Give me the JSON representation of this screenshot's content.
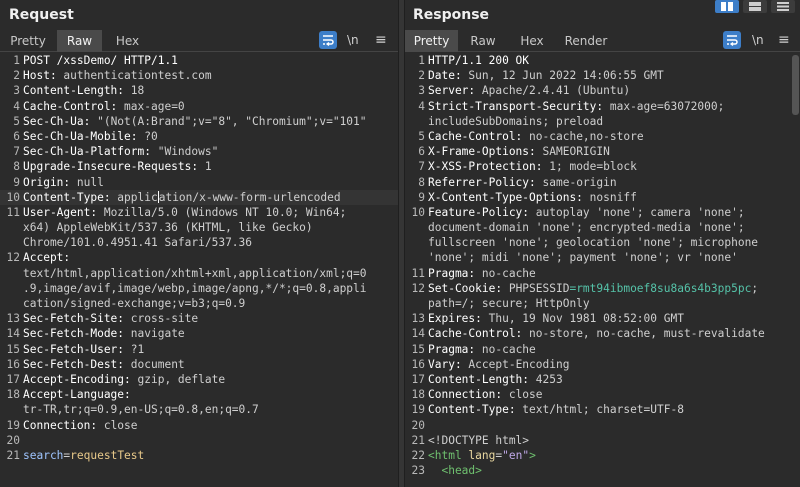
{
  "request": {
    "title": "Request",
    "tabs": [
      "Pretty",
      "Raw",
      "Hex"
    ],
    "active_tab": "Raw",
    "newline_label": "\\n",
    "lines": [
      {
        "n": "1",
        "segs": [
          {
            "t": "POST /xssDemo/ HTTP/1.1",
            "c": "hkey"
          }
        ]
      },
      {
        "n": "2",
        "segs": [
          {
            "t": "Host: ",
            "c": "hkey"
          },
          {
            "t": "authenticationtest.com",
            "c": "hval"
          }
        ]
      },
      {
        "n": "3",
        "segs": [
          {
            "t": "Content-Length: ",
            "c": "hkey"
          },
          {
            "t": "18",
            "c": "hval"
          }
        ]
      },
      {
        "n": "4",
        "segs": [
          {
            "t": "Cache-Control: ",
            "c": "hkey"
          },
          {
            "t": "max-age=0",
            "c": "hval"
          }
        ]
      },
      {
        "n": "5",
        "segs": [
          {
            "t": "Sec-Ch-Ua: ",
            "c": "hkey"
          },
          {
            "t": "\"(Not(A:Brand\";v=\"8\", \"Chromium\";v=\"101\"",
            "c": "hval"
          }
        ]
      },
      {
        "n": "6",
        "segs": [
          {
            "t": "Sec-Ch-Ua-Mobile: ",
            "c": "hkey"
          },
          {
            "t": "?0",
            "c": "hval"
          }
        ]
      },
      {
        "n": "7",
        "segs": [
          {
            "t": "Sec-Ch-Ua-Platform: ",
            "c": "hkey"
          },
          {
            "t": "\"Windows\"",
            "c": "hval"
          }
        ]
      },
      {
        "n": "8",
        "segs": [
          {
            "t": "Upgrade-Insecure-Requests: ",
            "c": "hkey"
          },
          {
            "t": "1",
            "c": "hval"
          }
        ]
      },
      {
        "n": "9",
        "segs": [
          {
            "t": "Origin: ",
            "c": "hkey"
          },
          {
            "t": "null",
            "c": "hval"
          }
        ]
      },
      {
        "n": "10",
        "hl": true,
        "segs": [
          {
            "t": "Content-Type: ",
            "c": "hkey"
          },
          {
            "t": "applic",
            "c": "hval"
          },
          {
            "caret": true
          },
          {
            "t": "ation/x-www-form-urlencoded",
            "c": "hval"
          }
        ]
      },
      {
        "n": "11",
        "segs": [
          {
            "t": "User-Agent: ",
            "c": "hkey"
          },
          {
            "t": "Mozilla/5.0 (Windows NT 10.0; Win64;",
            "c": "hval"
          }
        ]
      },
      {
        "n": "",
        "segs": [
          {
            "t": "x64) AppleWebKit/537.36 (KHTML, like Gecko)",
            "c": "hval"
          }
        ]
      },
      {
        "n": "",
        "segs": [
          {
            "t": "Chrome/101.0.4951.41 Safari/537.36",
            "c": "hval"
          }
        ]
      },
      {
        "n": "12",
        "segs": [
          {
            "t": "Accept:",
            "c": "hkey"
          }
        ]
      },
      {
        "n": "",
        "segs": [
          {
            "t": "text/html,application/xhtml+xml,application/xml;q=0",
            "c": "hval"
          }
        ]
      },
      {
        "n": "",
        "segs": [
          {
            "t": ".9,image/avif,image/webp,image/apng,*/*;q=0.8,appli",
            "c": "hval"
          }
        ]
      },
      {
        "n": "",
        "segs": [
          {
            "t": "cation/signed-exchange;v=b3;q=0.9",
            "c": "hval"
          }
        ]
      },
      {
        "n": "13",
        "segs": [
          {
            "t": "Sec-Fetch-Site: ",
            "c": "hkey"
          },
          {
            "t": "cross-site",
            "c": "hval"
          }
        ]
      },
      {
        "n": "14",
        "segs": [
          {
            "t": "Sec-Fetch-Mode: ",
            "c": "hkey"
          },
          {
            "t": "navigate",
            "c": "hval"
          }
        ]
      },
      {
        "n": "15",
        "segs": [
          {
            "t": "Sec-Fetch-User: ",
            "c": "hkey"
          },
          {
            "t": "?1",
            "c": "hval"
          }
        ]
      },
      {
        "n": "16",
        "segs": [
          {
            "t": "Sec-Fetch-Dest: ",
            "c": "hkey"
          },
          {
            "t": "document",
            "c": "hval"
          }
        ]
      },
      {
        "n": "17",
        "segs": [
          {
            "t": "Accept-Encoding: ",
            "c": "hkey"
          },
          {
            "t": "gzip, deflate",
            "c": "hval"
          }
        ]
      },
      {
        "n": "18",
        "segs": [
          {
            "t": "Accept-Language:",
            "c": "hkey"
          }
        ]
      },
      {
        "n": "",
        "segs": [
          {
            "t": "tr-TR,tr;q=0.9,en-US;q=0.8,en;q=0.7",
            "c": "hval"
          }
        ]
      },
      {
        "n": "19",
        "segs": [
          {
            "t": "Connection: ",
            "c": "hkey"
          },
          {
            "t": "close",
            "c": "hval"
          }
        ]
      },
      {
        "n": "20",
        "segs": []
      },
      {
        "n": "21",
        "segs": [
          {
            "t": "search",
            "c": "paramk"
          },
          {
            "t": "=",
            "c": "hval"
          },
          {
            "t": "requestTest",
            "c": "paramv"
          }
        ]
      }
    ]
  },
  "response": {
    "title": "Response",
    "tabs": [
      "Pretty",
      "Raw",
      "Hex",
      "Render"
    ],
    "active_tab": "Pretty",
    "newline_label": "\\n",
    "lines": [
      {
        "n": "1",
        "segs": [
          {
            "t": "HTTP/1.1 200 OK",
            "c": "hkey"
          }
        ]
      },
      {
        "n": "2",
        "segs": [
          {
            "t": "Date: ",
            "c": "hkey"
          },
          {
            "t": "Sun, 12 Jun 2022 14:06:55 GMT",
            "c": "hval"
          }
        ]
      },
      {
        "n": "3",
        "segs": [
          {
            "t": "Server: ",
            "c": "hkey"
          },
          {
            "t": "Apache/2.4.41 (Ubuntu)",
            "c": "hval"
          }
        ]
      },
      {
        "n": "4",
        "segs": [
          {
            "t": "Strict-Transport-Security: ",
            "c": "hkey"
          },
          {
            "t": "max-age=63072000;",
            "c": "hval"
          }
        ]
      },
      {
        "n": "",
        "segs": [
          {
            "t": "includeSubDomains; preload",
            "c": "hval"
          }
        ]
      },
      {
        "n": "5",
        "segs": [
          {
            "t": "Cache-Control: ",
            "c": "hkey"
          },
          {
            "t": "no-cache,no-store",
            "c": "hval"
          }
        ]
      },
      {
        "n": "6",
        "segs": [
          {
            "t": "X-Frame-Options: ",
            "c": "hkey"
          },
          {
            "t": "SAMEORIGIN",
            "c": "hval"
          }
        ]
      },
      {
        "n": "7",
        "segs": [
          {
            "t": "X-XSS-Protection: ",
            "c": "hkey"
          },
          {
            "t": "1; mode=block",
            "c": "hval"
          }
        ]
      },
      {
        "n": "8",
        "segs": [
          {
            "t": "Referrer-Policy: ",
            "c": "hkey"
          },
          {
            "t": "same-origin",
            "c": "hval"
          }
        ]
      },
      {
        "n": "9",
        "segs": [
          {
            "t": "X-Content-Type-Options: ",
            "c": "hkey"
          },
          {
            "t": "nosniff",
            "c": "hval"
          }
        ]
      },
      {
        "n": "10",
        "segs": [
          {
            "t": "Feature-Policy: ",
            "c": "hkey"
          },
          {
            "t": "autoplay 'none'; camera 'none';",
            "c": "hval"
          }
        ]
      },
      {
        "n": "",
        "segs": [
          {
            "t": "document-domain 'none'; encrypted-media 'none';",
            "c": "hval"
          }
        ]
      },
      {
        "n": "",
        "segs": [
          {
            "t": "fullscreen 'none'; geolocation 'none'; microphone",
            "c": "hval"
          }
        ]
      },
      {
        "n": "",
        "segs": [
          {
            "t": "'none'; midi 'none'; payment 'none'; vr 'none'",
            "c": "hval"
          }
        ]
      },
      {
        "n": "11",
        "segs": [
          {
            "t": "Pragma: ",
            "c": "hkey"
          },
          {
            "t": "no-cache",
            "c": "hval"
          }
        ]
      },
      {
        "n": "12",
        "segs": [
          {
            "t": "Set-Cookie: ",
            "c": "hkey"
          },
          {
            "t": "PHPSESSID",
            "c": "hval"
          },
          {
            "t": "=rmt94ibmoef8su8a6s4b3pp5pc",
            "c": "cookie"
          },
          {
            "t": ";",
            "c": "hval"
          }
        ]
      },
      {
        "n": "",
        "segs": [
          {
            "t": "path=/; secure; HttpOnly",
            "c": "hval"
          }
        ]
      },
      {
        "n": "13",
        "segs": [
          {
            "t": "Expires: ",
            "c": "hkey"
          },
          {
            "t": "Thu, 19 Nov 1981 08:52:00 GMT",
            "c": "hval"
          }
        ]
      },
      {
        "n": "14",
        "segs": [
          {
            "t": "Cache-Control: ",
            "c": "hkey"
          },
          {
            "t": "no-store, no-cache, must-revalidate",
            "c": "hval"
          }
        ]
      },
      {
        "n": "15",
        "segs": [
          {
            "t": "Pragma: ",
            "c": "hkey"
          },
          {
            "t": "no-cache",
            "c": "hval"
          }
        ]
      },
      {
        "n": "16",
        "segs": [
          {
            "t": "Vary: ",
            "c": "hkey"
          },
          {
            "t": "Accept-Encoding",
            "c": "hval"
          }
        ]
      },
      {
        "n": "17",
        "segs": [
          {
            "t": "Content-Length: ",
            "c": "hkey"
          },
          {
            "t": "4253",
            "c": "hval"
          }
        ]
      },
      {
        "n": "18",
        "segs": [
          {
            "t": "Connection: ",
            "c": "hkey"
          },
          {
            "t": "close",
            "c": "hval"
          }
        ]
      },
      {
        "n": "19",
        "segs": [
          {
            "t": "Content-Type: ",
            "c": "hkey"
          },
          {
            "t": "text/html; charset=UTF-8",
            "c": "hval"
          }
        ]
      },
      {
        "n": "20",
        "segs": []
      },
      {
        "n": "21",
        "segs": [
          {
            "t": "<!DOCTYPE html>",
            "c": "hval"
          }
        ]
      },
      {
        "n": "22",
        "segs": [
          {
            "t": "<html ",
            "c": "tag"
          },
          {
            "t": "lang",
            "c": "attr"
          },
          {
            "t": "=",
            "c": "hval"
          },
          {
            "t": "\"en\"",
            "c": "str"
          },
          {
            "t": ">",
            "c": "tag"
          }
        ]
      },
      {
        "n": "23",
        "segs": [
          {
            "t": "  <head>",
            "c": "tag"
          }
        ]
      }
    ]
  },
  "layout_toggle": {
    "icons": [
      "side-by-side-icon",
      "stacked-icon",
      "single-pane-icon"
    ],
    "active": 0
  },
  "colors": {
    "accent": "#3d7ec8",
    "background": "#2b2b2b",
    "tab_active": "#4a4a4a",
    "cookie_value": "#55c2a8"
  }
}
